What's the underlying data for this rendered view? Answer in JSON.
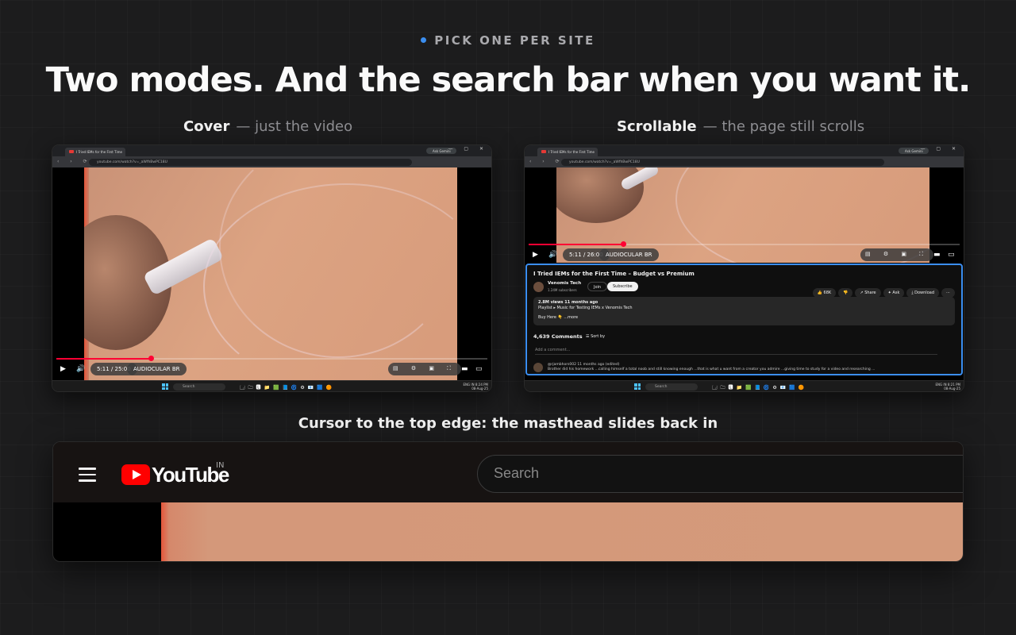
{
  "eyebrow": "PICK ONE PER SITE",
  "headline": "Two modes. And the search bar when you want it.",
  "modes": [
    {
      "name": "Cover",
      "desc": "— just the video"
    },
    {
      "name": "Scrollable",
      "desc": "— the page still scrolls"
    }
  ],
  "browser": {
    "tab_title": "I Tried IEMs for the First Time",
    "gemini": "Ask Gemini",
    "url": "youtube.com/watch?v=_aWfhBwPC18U",
    "window_controls": "— ▢ ✕",
    "nav_icons": "‹ › ⟳"
  },
  "player": {
    "time_cover": "5:11 / 25:00",
    "time_scroll": "5:11 / 26:00",
    "chapter": "AUDIOCULAR BR",
    "right_controls": "▤ ⚙ ▣ ⛶",
    "play_icon": "play-icon",
    "volume_icon": "volume-icon",
    "progress_fraction": 0.22
  },
  "taskbar": {
    "search": "Search",
    "apps": "🗔🗀🅻📁🟩📘🌀⚙📧🟦🟠",
    "clock_lang": "ENG IN",
    "clock_time": "8:24 PM",
    "clock_date": "08-Aug-25",
    "clock_time_2": "8:21 PM"
  },
  "scroll": {
    "title": "I Tried IEMs for the First Time – Budget vs Premium",
    "channel": "Venomis Tech",
    "subs": "1.24M subscribers",
    "join": "Join",
    "subscribe": "Subscribe",
    "actions": [
      "👍 68K",
      "👎",
      "↗ Share",
      "✦ Ask",
      "⤓ Download",
      "⋯"
    ],
    "desc_line1": "2.8M views  11 months ago",
    "desc_line2": "Playlist  ▸ Music for Testing IEMs x Venomis Tech",
    "desc_line3": "Buy Here 👇  ...more",
    "comments": "4,639 Comments",
    "sort": "☰ Sort by",
    "add_comment": "Add a comment...",
    "comment_author": "@rjambhors002 11 months ago (edited)",
    "comment_text": "Brother did his homework ...calling himself a total noob and still knowing enough ...that is what u want from a creator you admire ...giving time to study for a video and researching ..."
  },
  "masthead_caption": "Cursor to the top edge: the masthead slides back in",
  "masthead": {
    "logo_text": "YouTube",
    "region": "IN",
    "search_placeholder": "Search"
  }
}
